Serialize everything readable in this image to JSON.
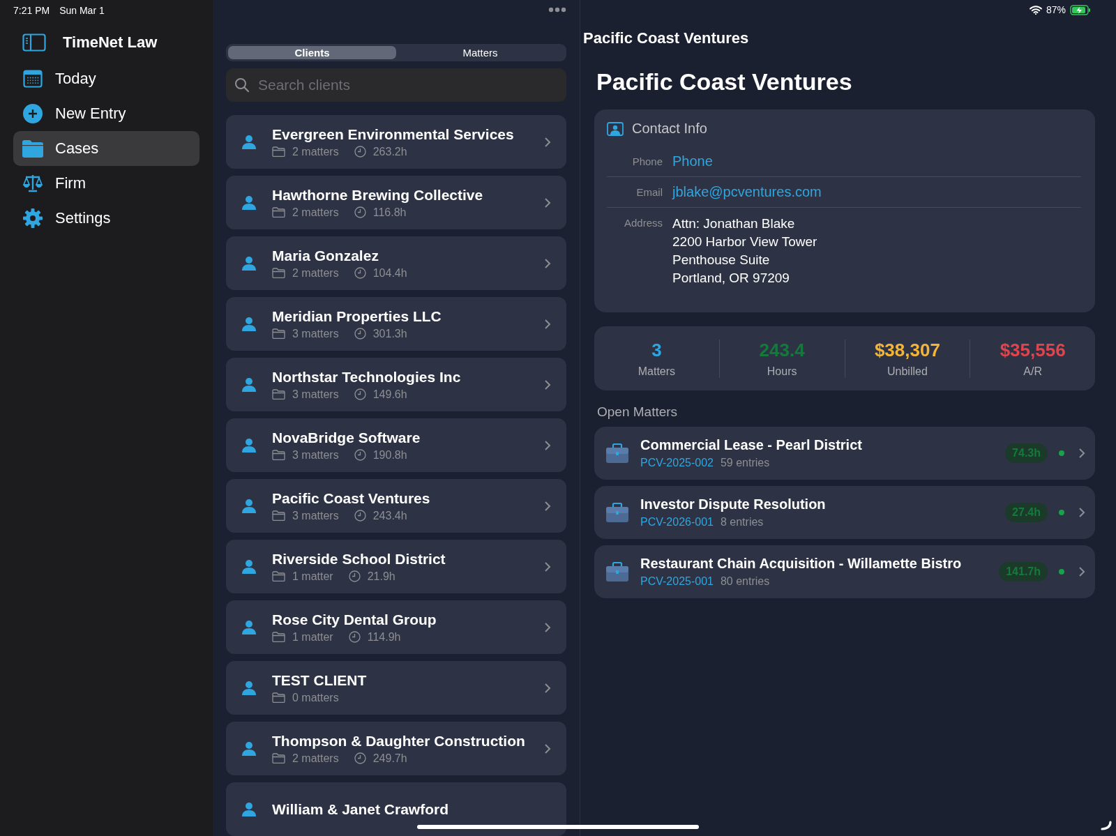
{
  "status_bar": {
    "time": "7:21 PM",
    "date": "Sun Mar 1",
    "battery": "87%"
  },
  "sidebar": {
    "title": "TimeNet Law",
    "items": [
      {
        "label": "Today",
        "kind": "calendar",
        "selected": false
      },
      {
        "label": "New Entry",
        "kind": "plus",
        "selected": false
      },
      {
        "label": "Cases",
        "kind": "folder",
        "selected": true
      },
      {
        "label": "Firm",
        "kind": "scale",
        "selected": false
      },
      {
        "label": "Settings",
        "kind": "gear",
        "selected": false
      }
    ]
  },
  "tabs": [
    {
      "label": "Clients",
      "selected": true
    },
    {
      "label": "Matters",
      "selected": false
    }
  ],
  "search": {
    "placeholder": "Search clients"
  },
  "clients": [
    {
      "name": "Evergreen Environmental Services",
      "matters": "2 matters",
      "hours": "263.2h"
    },
    {
      "name": "Hawthorne Brewing Collective",
      "matters": "2 matters",
      "hours": "116.8h"
    },
    {
      "name": "Maria Gonzalez",
      "matters": "2 matters",
      "hours": "104.4h"
    },
    {
      "name": "Meridian Properties LLC",
      "matters": "3 matters",
      "hours": "301.3h"
    },
    {
      "name": "Northstar Technologies Inc",
      "matters": "3 matters",
      "hours": "149.6h"
    },
    {
      "name": "NovaBridge Software",
      "matters": "3 matters",
      "hours": "190.8h"
    },
    {
      "name": "Pacific Coast Ventures",
      "matters": "3 matters",
      "hours": "243.4h"
    },
    {
      "name": "Riverside School District",
      "matters": "1 matter",
      "hours": "21.9h"
    },
    {
      "name": "Rose City Dental Group",
      "matters": "1 matter",
      "hours": "114.9h"
    },
    {
      "name": "TEST CLIENT",
      "matters": "0 matters"
    },
    {
      "name": "Thompson & Daughter Construction",
      "matters": "2 matters",
      "hours": "249.7h"
    },
    {
      "name": "William & Janet Crawford"
    }
  ],
  "detail": {
    "nav_title": "Pacific Coast Ventures",
    "title": "Pacific Coast Ventures",
    "contact": {
      "heading": "Contact Info",
      "fields": [
        {
          "label": "Phone",
          "value": "Phone",
          "kind": "link"
        },
        {
          "label": "Email",
          "value": "jblake@pcventures.com",
          "kind": "link"
        },
        {
          "label": "Address",
          "kind": "lines",
          "lines": [
            "Attn: Jonathan Blake",
            "2200 Harbor View Tower",
            "Penthouse Suite",
            "Portland, OR 97209"
          ]
        }
      ]
    },
    "stats": [
      {
        "value": "3",
        "label": "Matters",
        "color": "#2fa6e0"
      },
      {
        "value": "243.4",
        "label": "Hours",
        "color": "#137a3c"
      },
      {
        "value": "$38,307",
        "label": "Unbilled",
        "color": "#f2b53a"
      },
      {
        "value": "$35,556",
        "label": "A/R",
        "color": "#e0444c"
      }
    ],
    "open_matters_heading": "Open Matters",
    "matters": [
      {
        "title": "Commercial Lease - Pearl District",
        "code": "PCV-2025-002",
        "entries": "59 entries",
        "hours": "74.3h",
        "color": "#16a34a"
      },
      {
        "title": "Investor Dispute Resolution",
        "code": "PCV-2026-001",
        "entries": "8 entries",
        "hours": "27.4h",
        "color": "#16a34a"
      },
      {
        "title": "Restaurant Chain Acquisition - Willamette Bistro",
        "code": "PCV-2025-001",
        "entries": "80 entries",
        "hours": "141.7h",
        "color": "#16a34a"
      }
    ]
  }
}
